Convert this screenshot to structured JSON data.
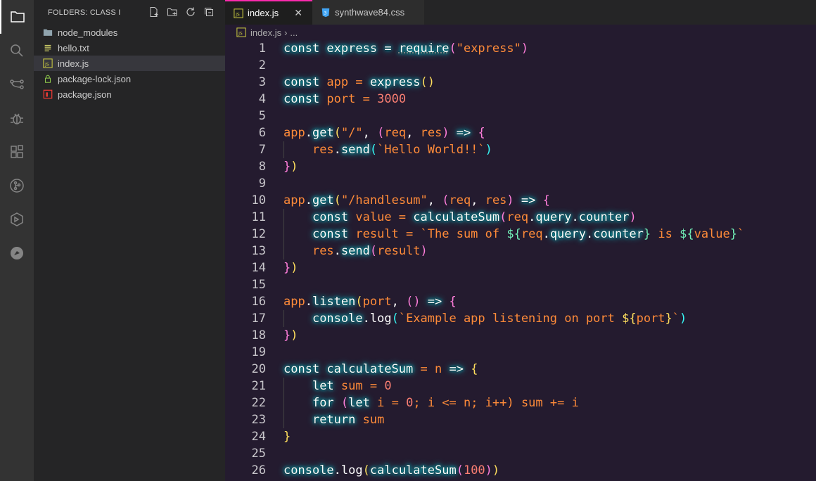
{
  "sidebar": {
    "title": "FOLDERS: CLASS I",
    "items": [
      {
        "label": "node_modules",
        "icon": "folder-icon"
      },
      {
        "label": "hello.txt",
        "icon": "text-file-icon"
      },
      {
        "label": "index.js",
        "icon": "js-file-icon"
      },
      {
        "label": "package-lock.json",
        "icon": "lock-json-icon"
      },
      {
        "label": "package.json",
        "icon": "npm-json-icon"
      }
    ]
  },
  "tabs": [
    {
      "label": "index.js",
      "icon": "js-file-icon"
    },
    {
      "label": "synthwave84.css",
      "icon": "css-file-icon"
    }
  ],
  "breadcrumb": {
    "file": "index.js",
    "more": "..."
  },
  "code_lines": [
    {
      "n": "1"
    },
    {
      "n": "2"
    },
    {
      "n": "3"
    },
    {
      "n": "4"
    },
    {
      "n": "5"
    },
    {
      "n": "6"
    },
    {
      "n": "7"
    },
    {
      "n": "8"
    },
    {
      "n": "9"
    },
    {
      "n": "10"
    },
    {
      "n": "11"
    },
    {
      "n": "12"
    },
    {
      "n": "13"
    },
    {
      "n": "14"
    },
    {
      "n": "15"
    },
    {
      "n": "16"
    },
    {
      "n": "17"
    },
    {
      "n": "18"
    },
    {
      "n": "19"
    },
    {
      "n": "20"
    },
    {
      "n": "21"
    },
    {
      "n": "22"
    },
    {
      "n": "23"
    },
    {
      "n": "24"
    },
    {
      "n": "25"
    },
    {
      "n": "26"
    }
  ],
  "code": {
    "l1": [
      "const",
      " express ",
      "=",
      " ",
      "require",
      "(",
      "\"express\"",
      ")"
    ],
    "l3": [
      "const",
      " app ",
      "=",
      " ",
      "express",
      "()"
    ],
    "l4": [
      "const",
      " port ",
      "=",
      " ",
      "3000"
    ],
    "l6": [
      "app",
      ".",
      "get",
      "(",
      "\"/\"",
      ", ",
      "(",
      "req",
      ", ",
      "res",
      ")",
      " => ",
      "{"
    ],
    "l7": [
      "res",
      ".",
      "send",
      "(",
      "`Hello World!!`",
      ")"
    ],
    "l8": [
      "}",
      ")"
    ],
    "l10": [
      "app",
      ".",
      "get",
      "(",
      "\"/handlesum\"",
      ", ",
      "(",
      "req",
      ", ",
      "res",
      ")",
      " => ",
      "{"
    ],
    "l11": [
      "const",
      " value ",
      "=",
      " ",
      "calculateSum",
      "(",
      "req",
      ".",
      "query",
      ".",
      "counter",
      ")"
    ],
    "l12": [
      "const",
      " result ",
      "=",
      " ",
      "`The sum of ",
      "${",
      "req",
      ".",
      "query",
      ".",
      "counter",
      "}",
      " is ",
      "${",
      "value",
      "}",
      "`"
    ],
    "l13": [
      "res",
      ".",
      "send",
      "(",
      "result",
      ")"
    ],
    "l14": [
      "}",
      ")"
    ],
    "l16": [
      "app",
      ".",
      "listen",
      "(",
      "port",
      ", ",
      "()",
      " => ",
      "{"
    ],
    "l17": [
      "console",
      ".",
      "log",
      "(",
      "`Example app listening on port ",
      "${",
      "port",
      "}",
      "`",
      ")"
    ],
    "l18": [
      "}",
      ")"
    ],
    "l20": [
      "const",
      " calculateSum ",
      "=",
      " ",
      "n",
      " => ",
      "{"
    ],
    "l21": [
      "let",
      " sum ",
      "=",
      " ",
      "0"
    ],
    "l22": [
      "for",
      " ",
      "(",
      "let",
      " i ",
      "=",
      " ",
      "0",
      "; i ",
      "<=",
      " n; i",
      "++",
      ") sum ",
      "+=",
      " i"
    ],
    "l23": [
      "return",
      " sum"
    ],
    "l24": [
      "}"
    ],
    "l26": [
      "console",
      ".",
      "log",
      "(",
      "calculateSum",
      "(",
      "100",
      ")",
      ")"
    ]
  },
  "colors": {
    "accent": "#f92aad",
    "editor_bg": "#241b2f",
    "sidebar_bg": "#252526",
    "activity_bg": "#333333"
  }
}
